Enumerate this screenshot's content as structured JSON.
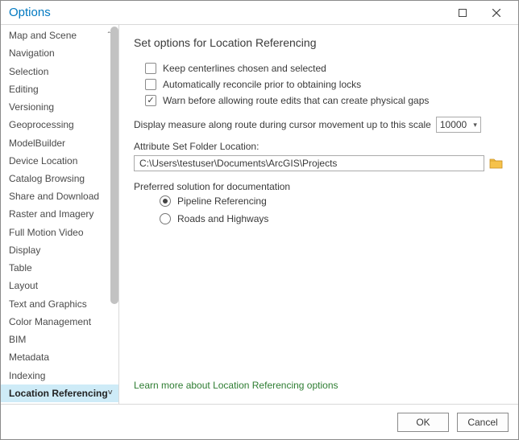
{
  "window": {
    "title": "Options"
  },
  "sidebar": {
    "items": [
      {
        "label": "Map and Scene"
      },
      {
        "label": "Navigation"
      },
      {
        "label": "Selection"
      },
      {
        "label": "Editing"
      },
      {
        "label": "Versioning"
      },
      {
        "label": "Geoprocessing"
      },
      {
        "label": "ModelBuilder"
      },
      {
        "label": "Device Location"
      },
      {
        "label": "Catalog Browsing"
      },
      {
        "label": "Share and Download"
      },
      {
        "label": "Raster and Imagery"
      },
      {
        "label": "Full Motion Video"
      },
      {
        "label": "Display"
      },
      {
        "label": "Table"
      },
      {
        "label": "Layout"
      },
      {
        "label": "Text and Graphics"
      },
      {
        "label": "Color Management"
      },
      {
        "label": "BIM"
      },
      {
        "label": "Metadata"
      },
      {
        "label": "Indexing"
      },
      {
        "label": "Location Referencing",
        "selected": true
      }
    ]
  },
  "main": {
    "heading": "Set options for Location Referencing",
    "checkboxes": {
      "keep": "Keep centerlines chosen and selected",
      "auto": "Automatically reconcile prior to obtaining locks",
      "warn": "Warn before allowing route edits that can create physical gaps"
    },
    "scale_label": "Display measure along route during cursor movement up to this scale",
    "scale_value": "10000",
    "attr_label": "Attribute Set Folder Location:",
    "attr_path": "C:\\Users\\testuser\\Documents\\ArcGIS\\Projects",
    "pref_label": "Preferred solution for documentation",
    "radios": {
      "pipeline": "Pipeline Referencing",
      "roads": "Roads and Highways"
    },
    "learn_link": "Learn more about Location Referencing options"
  },
  "footer": {
    "ok": "OK",
    "cancel": "Cancel"
  }
}
